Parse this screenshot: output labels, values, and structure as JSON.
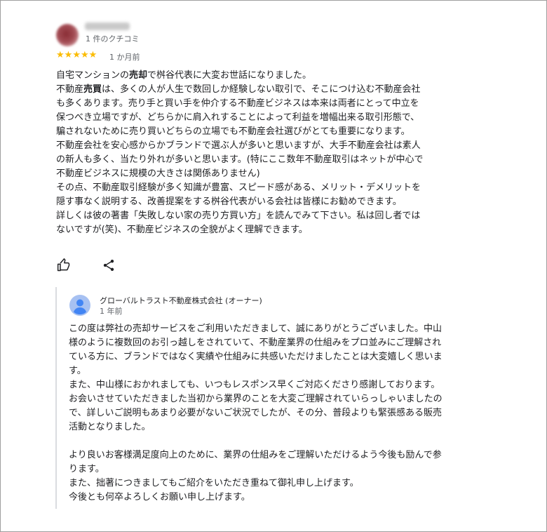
{
  "review": {
    "reviewer_review_count": "1 件のクチコミ",
    "rating": 5,
    "star_glyph": "★",
    "time_ago": "1 か月前",
    "body_lines": [
      [
        {
          "t": "自宅マンションの"
        },
        {
          "t": "売却",
          "b": true
        },
        {
          "t": "で桝谷代表に大変お世話になりました。"
        }
      ],
      [
        {
          "t": "不動産"
        },
        {
          "t": "売買",
          "b": true
        },
        {
          "t": "は、多くの人が人生で数回しか経験しない取引で、そこにつけ込む不動産会社"
        }
      ],
      [
        {
          "t": "も多くあります。売り手と買い手を仲介する不動産ビジネスは本来は両者にとって中立を"
        }
      ],
      [
        {
          "t": "保つべき立場ですが、どちらかに肩入れすることによって利益を増幅出来る取引形態で、"
        }
      ],
      [
        {
          "t": "騙されないために売り買いどちらの立場でも不動産会社選びがとても重要になります。"
        }
      ],
      [
        {
          "t": "不動産会社を安心感からかブランドで選ぶ人が多いと思いますが、大手不動産会社は素人"
        }
      ],
      [
        {
          "t": "の新人も多く、当たり外れが多いと思います。(特にここ数年不動産取引はネットが中心で"
        }
      ],
      [
        {
          "t": "不動産ビジネスに規模の大きさは関係ありません)"
        }
      ],
      [
        {
          "t": "その点、不動産取引経験が多く知識が豊富、スピード感がある、メリット・デメリットを"
        }
      ],
      [
        {
          "t": "隠す事なく説明する、改善提案をする桝谷代表がいる会社は皆様にお勧めできます。"
        }
      ],
      [
        {
          "t": "詳しくは彼の著書「失敗しない家の売り方買い方」を読んでみて下さい。私は回し者では"
        }
      ],
      [
        {
          "t": "ないですが(笑)、不動産ビジネスの全貌がよく理解できます。"
        }
      ]
    ],
    "actions": {
      "like_icon": "thumbs-up-icon",
      "share_icon": "share-icon"
    }
  },
  "owner_reply": {
    "owner_name": "グローバルトラスト不動産株式会社 (オーナー)",
    "time_ago": "1 年前",
    "avatar_icon": "person-avatar-icon",
    "body_lines": [
      "この度は弊社の売却サービスをご利用いただきまして、誠にありがとうございました。中山",
      "様のように複数回のお引っ越しをされていて、不動産業界の仕組みをプロ並みにご理解され",
      "ている方に、ブランドではなく実績や仕組みに共感いただけましたことは大変嬉しく思いま",
      "す。",
      "また、中山様におかれましても、いつもレスポンス早くご対応くださり感謝しております。",
      "お会いさせていただきました当初から業界のことを大変ご理解されていらっしゃいましたの",
      "で、詳しいご説明もあまり必要がないご状況でしたが、その分、普段よりも緊張感ある販売",
      "活動となりました。",
      "",
      "より良いお客様満足度向上のために、業界の仕組みをご理解いただけるよう今後も励んで参",
      "ります。",
      "また、拙著につきましてもご紹介をいただき重ねて御礼申し上げます。",
      "今後とも何卒よろしくお願い申し上げます。"
    ]
  },
  "colors": {
    "star": "#fbbc04",
    "secondary_text": "#5f6368",
    "primary_text": "#202124",
    "avatar_bg": "#a7c1f2",
    "avatar_fg": "#4285f4",
    "reply_bar": "#dadce0"
  }
}
